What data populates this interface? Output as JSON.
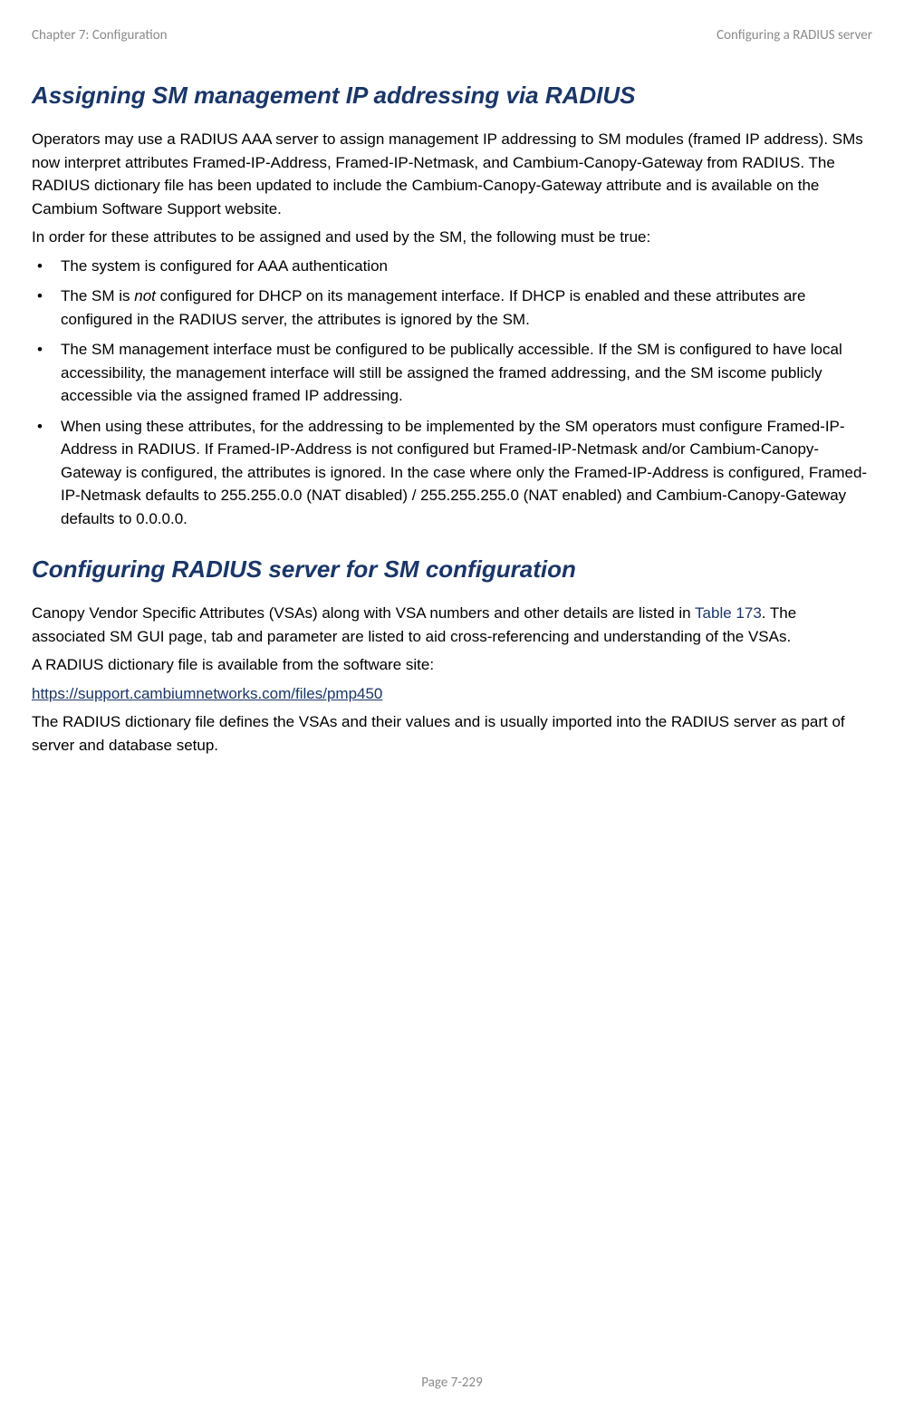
{
  "header": {
    "left": "Chapter 7:  Configuration",
    "right": "Configuring a RADIUS server"
  },
  "section1": {
    "title": "Assigning SM management IP addressing via RADIUS",
    "para1": "Operators may use a RADIUS AAA server to assign management IP addressing to SM modules (framed IP address). SMs now interpret attributes Framed-IP-Address, Framed-IP-Netmask, and Cambium-Canopy-Gateway from RADIUS. The RADIUS dictionary file has been updated to include the Cambium-Canopy-Gateway attribute and is available on the Cambium Software Support website.",
    "para2": "In order for these attributes to be assigned and used by the SM, the following must be true:",
    "bullets": {
      "b1": "The system is configured for AAA authentication",
      "b2_pre": "The SM is ",
      "b2_italic": "not",
      "b2_post": " configured for DHCP on its management interface. If DHCP is enabled and these attributes are configured in the RADIUS server, the attributes is ignored by the SM.",
      "b3": "The SM management interface must be configured to be publically accessible. If the SM is configured to have local accessibility, the management interface will still be assigned the framed addressing, and the SM iscome publicly accessible via the assigned framed IP addressing.",
      "b4": "When using these attributes, for the addressing to be implemented by the SM operators must configure Framed-IP-Address in RADIUS. If Framed-IP-Address is not configured but Framed-IP-Netmask and/or Cambium-Canopy-Gateway is configured, the attributes is ignored. In the case where only the Framed-IP-Address is configured, Framed-IP-Netmask defaults to 255.255.0.0 (NAT disabled) / 255.255.255.0 (NAT enabled) and Cambium-Canopy-Gateway defaults to 0.0.0.0."
    }
  },
  "section2": {
    "title": "Configuring RADIUS server for SM configuration",
    "para1_pre": "Canopy Vendor Specific Attributes (VSAs) along with VSA numbers and other details are listed in ",
    "para1_ref": "Table 173",
    "para1_post": ". The associated SM GUI page, tab and parameter are listed to aid cross-referencing and understanding of the VSAs.",
    "para2": "A RADIUS dictionary file is available from the software site:",
    "link_text": "https://support.cambiumnetworks.com/files/pmp450",
    "link_href": "https://support.cambiumnetworks.com/files/pmp450",
    "para3": "The RADIUS dictionary file defines the VSAs and their values and is usually imported into the RADIUS server as part of server and database setup."
  },
  "footer": {
    "page": "Page 7-229"
  }
}
